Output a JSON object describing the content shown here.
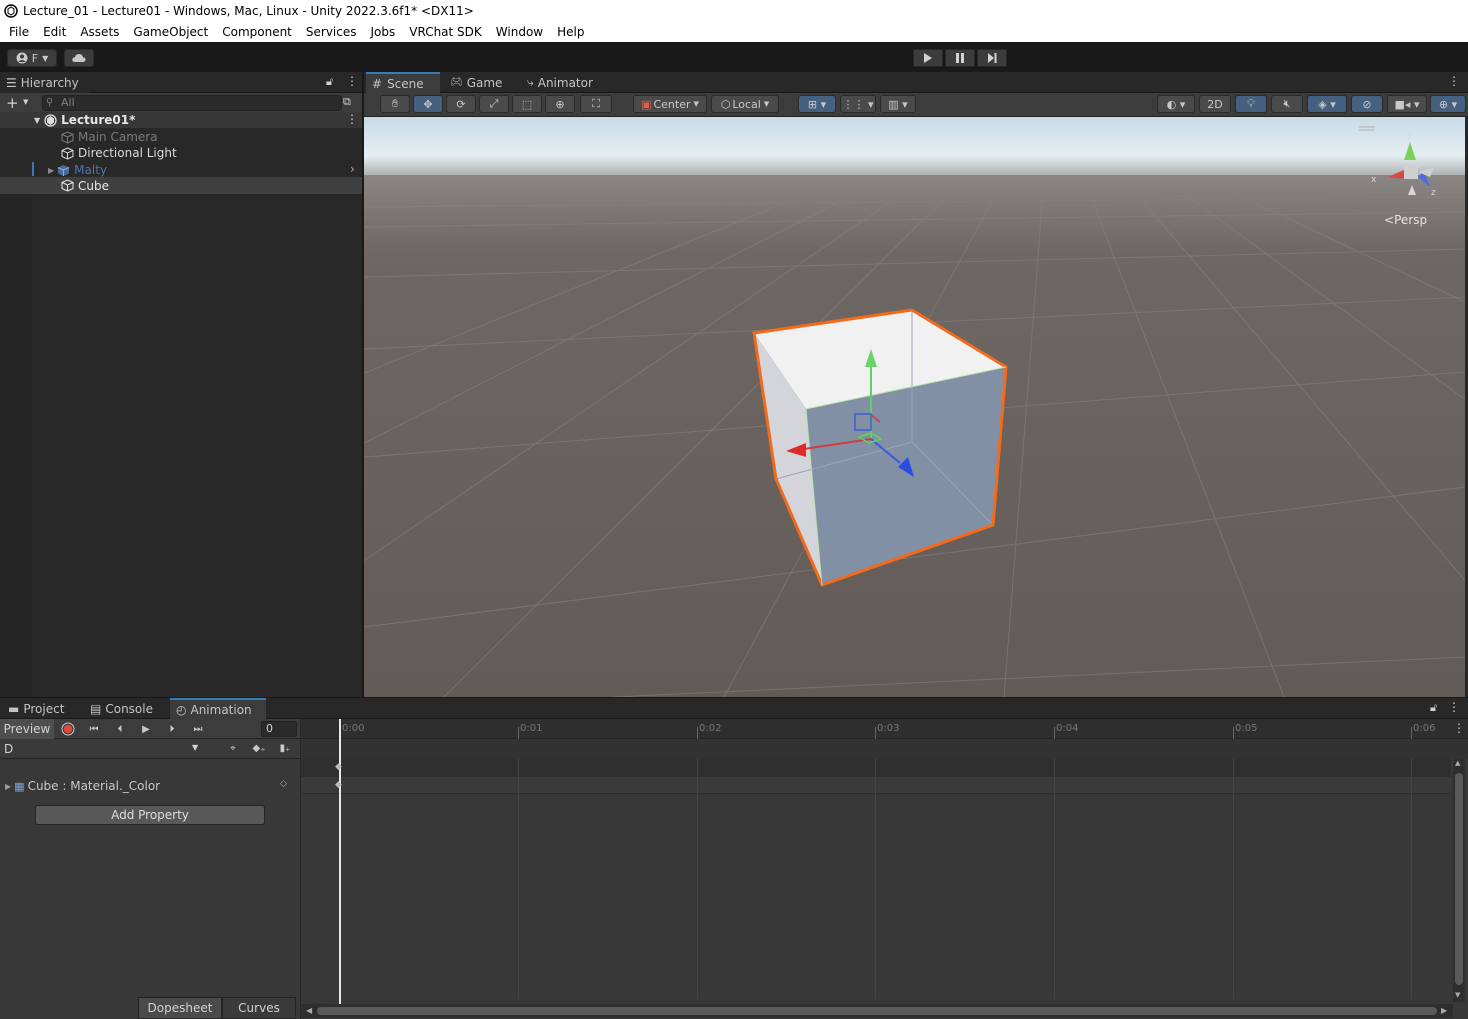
{
  "window": {
    "title": "Lecture_01 - Lecture01 - Windows, Mac, Linux - Unity 2022.3.6f1* <DX11>"
  },
  "menu": [
    "File",
    "Edit",
    "Assets",
    "GameObject",
    "Component",
    "Services",
    "Jobs",
    "VRChat SDK",
    "Window",
    "Help"
  ],
  "toolbar": {
    "account_label": "F"
  },
  "hierarchy": {
    "tab_label": "Hierarchy",
    "search_placeholder": "All",
    "scene_name": "Lecture01*",
    "items": [
      {
        "label": "Main Camera",
        "state": "disabled"
      },
      {
        "label": "Directional Light",
        "state": "normal"
      },
      {
        "label": "Malty",
        "state": "prefab-disabled"
      },
      {
        "label": "Cube",
        "state": "selected"
      }
    ]
  },
  "scene_view": {
    "tabs": [
      "Scene",
      "Game",
      "Animator"
    ],
    "pivot_mode": "Center",
    "pivot_rotation": "Local",
    "mode_2d_label": "2D",
    "gizmo_view_label": "Persp",
    "gizmo_axes": [
      "y",
      "x",
      "z"
    ]
  },
  "bottom_panel": {
    "tabs": [
      "Project",
      "Console",
      "Animation"
    ],
    "preview_label": "Preview",
    "frame_value": "0",
    "clip_name": "D",
    "timeline_ticks": [
      "0:00",
      "0:01",
      "0:02",
      "0:03",
      "0:04",
      "0:05",
      "0:06"
    ],
    "property_label": "Cube : Material._Color",
    "add_property_label": "Add Property",
    "dopesheet_label": "Dopesheet",
    "curves_label": "Curves"
  },
  "colors": {
    "selection_outline": "#f26b1d",
    "accent_blue": "#3a79bb",
    "record_red": "#e0483b"
  }
}
